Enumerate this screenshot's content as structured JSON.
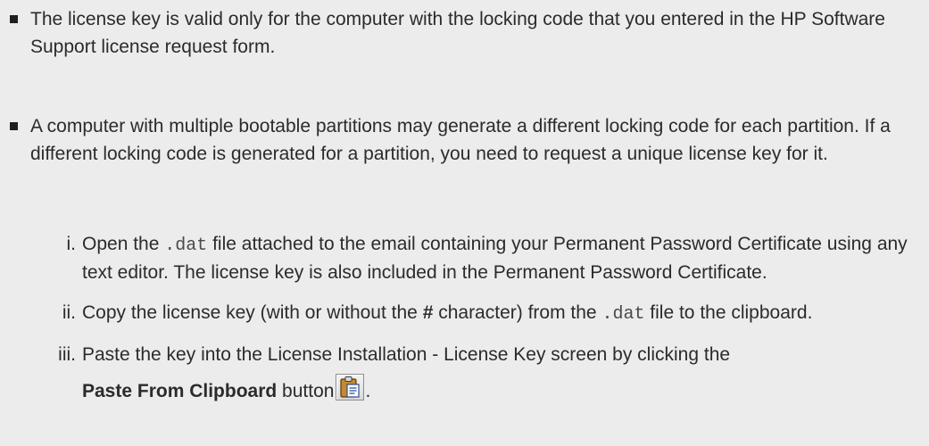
{
  "bullets": [
    {
      "text": "The license key is valid only for the computer with the locking code that you entered in the HP Software Support license request form."
    },
    {
      "text": "A computer with multiple bootable partitions may generate a different locking code for each partition. If a different locking code is generated for a partition, you need to request a unique license key for it."
    }
  ],
  "steps": [
    {
      "num": "i.",
      "part1": "Open the ",
      "code": ".dat",
      "part2": " file attached to the email containing your Permanent Password Certificate using any text editor. The license key is also included in the Permanent Password Certificate."
    },
    {
      "num": "ii.",
      "part1": "Copy the license key (with or without the ",
      "hash": "#",
      "part2": " character) from the ",
      "code": ".dat",
      "part3": " file to the clipboard."
    },
    {
      "num": "iii.",
      "part1": "Paste the key into the License Installation - License Key screen by clicking the",
      "bold": "Paste From Clipboard",
      "part2": " button",
      "end": ".",
      "icon": "paste-from-clipboard-icon"
    }
  ],
  "colors": {
    "background": "#ececec",
    "text": "#2b2b2b",
    "bullet": "#1f1f1f"
  }
}
